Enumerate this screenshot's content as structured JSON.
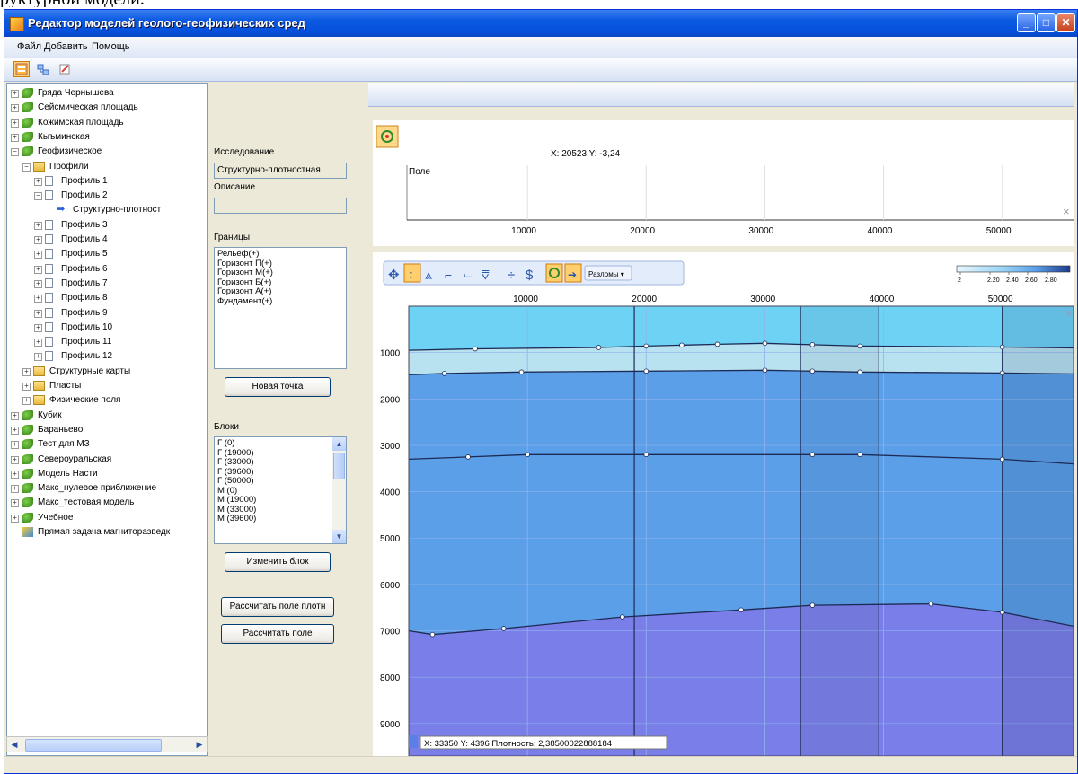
{
  "doc_text": "руктурной модели.",
  "window": {
    "title": "Редактор моделей геолого-геофизических сред",
    "minimize": "_",
    "maximize": "□",
    "close": "✕"
  },
  "menu": {
    "file": "Файл",
    "add": "Добавить",
    "help": "Помощь"
  },
  "tree": {
    "items": [
      {
        "label": "Гряда Чернышева",
        "icon": "leaf-icon",
        "level": 0,
        "exp": "+"
      },
      {
        "label": "Сейсмическая площадь",
        "icon": "leaf-icon",
        "level": 0,
        "exp": "+"
      },
      {
        "label": "Кожимская площадь",
        "icon": "leaf-icon",
        "level": 0,
        "exp": "+"
      },
      {
        "label": "Кыъминская",
        "icon": "leaf-icon",
        "level": 0,
        "exp": "+"
      },
      {
        "label": "Геофизическое",
        "icon": "leaf-icon",
        "level": 0,
        "exp": "−"
      },
      {
        "label": "Профили",
        "icon": "folder-icon",
        "level": 1,
        "exp": "−"
      },
      {
        "label": "Профиль 1",
        "icon": "doc-icon",
        "level": 2,
        "exp": "+"
      },
      {
        "label": "Профиль 2",
        "icon": "doc-icon",
        "level": 2,
        "exp": "−"
      },
      {
        "label": "Структурно-плотност",
        "icon": "arrow-icon",
        "level": 3,
        "exp": ""
      },
      {
        "label": "Профиль 3",
        "icon": "doc-icon",
        "level": 2,
        "exp": "+"
      },
      {
        "label": "Профиль 4",
        "icon": "doc-icon",
        "level": 2,
        "exp": "+"
      },
      {
        "label": "Профиль 5",
        "icon": "doc-icon",
        "level": 2,
        "exp": "+"
      },
      {
        "label": "Профиль 6",
        "icon": "doc-icon",
        "level": 2,
        "exp": "+"
      },
      {
        "label": "Профиль 7",
        "icon": "doc-icon",
        "level": 2,
        "exp": "+"
      },
      {
        "label": "Профиль 8",
        "icon": "doc-icon",
        "level": 2,
        "exp": "+"
      },
      {
        "label": "Профиль 9",
        "icon": "doc-icon",
        "level": 2,
        "exp": "+"
      },
      {
        "label": "Профиль 10",
        "icon": "doc-icon",
        "level": 2,
        "exp": "+"
      },
      {
        "label": "Профиль 11",
        "icon": "doc-icon",
        "level": 2,
        "exp": "+"
      },
      {
        "label": "Профиль 12",
        "icon": "doc-icon",
        "level": 2,
        "exp": "+"
      },
      {
        "label": "Структурные карты",
        "icon": "folder-icon",
        "level": 1,
        "exp": "+"
      },
      {
        "label": "Пласты",
        "icon": "folder-icon",
        "level": 1,
        "exp": "+"
      },
      {
        "label": "Физические поля",
        "icon": "folder-icon",
        "level": 1,
        "exp": "+"
      },
      {
        "label": "Кубик",
        "icon": "leaf-icon",
        "level": 0,
        "exp": "+"
      },
      {
        "label": "Бараньево",
        "icon": "leaf-icon",
        "level": 0,
        "exp": "+"
      },
      {
        "label": "Тест для МЗ",
        "icon": "leaf-icon",
        "level": 0,
        "exp": "+"
      },
      {
        "label": "Североуральская",
        "icon": "leaf-icon",
        "level": 0,
        "exp": "+"
      },
      {
        "label": "Модель Насти",
        "icon": "leaf-icon",
        "level": 0,
        "exp": "+"
      },
      {
        "label": "Макс_нулевое приближение",
        "icon": "leaf-icon",
        "level": 0,
        "exp": "+"
      },
      {
        "label": "Макс_тестовая модель",
        "icon": "leaf-icon",
        "level": 0,
        "exp": "+"
      },
      {
        "label": "Учебное",
        "icon": "leaf-icon",
        "level": 0,
        "exp": "+"
      },
      {
        "label": "Прямая задача магниторазведк",
        "icon": "cube-icon",
        "level": 0,
        "exp": ""
      }
    ]
  },
  "panel": {
    "research_label": "Исследование",
    "research_value": "Структурно-плотностная",
    "description_label": "Описание",
    "description_value": "",
    "boundaries_label": "Границы",
    "boundaries": [
      "Рельеф(+)",
      "Горизонт П(+)",
      "Горизонт М(+)",
      "Горизонт Б(+)",
      "Горизонт А(+)",
      "Фундамент(+)"
    ],
    "new_point_btn": "Новая точка",
    "blocks_label": "Блоки",
    "blocks": [
      "Г (0)",
      "Г (19000)",
      "Г (33000)",
      "Г (39600)",
      "Г (50000)",
      "М (0)",
      "М (19000)",
      "М (33000)",
      "М (39600)"
    ],
    "change_block_btn": "Изменить блок",
    "calc_density_btn": "Рассчитать поле плотн",
    "calc_field_btn": "Рассчитать поле"
  },
  "top_plot": {
    "coord_readout": "X: 20523 Y: -3,24",
    "field_label": "Поле",
    "x_ticks": [
      "10000",
      "20000",
      "30000",
      "40000",
      "50000"
    ],
    "close": "×"
  },
  "main_plot": {
    "palettes_btn": "Разломы ▾",
    "close": "×",
    "x_ticks": [
      "10000",
      "20000",
      "30000",
      "40000",
      "50000"
    ],
    "y_ticks": [
      "1000",
      "2000",
      "3000",
      "4000",
      "5000",
      "6000",
      "7000",
      "8000",
      "9000"
    ],
    "status": "X: 33350 Y: 4396 Плотность: 2,38500022888184",
    "legend_labels": [
      "2",
      "2.20",
      "2.40",
      "2.60",
      "2.80"
    ]
  },
  "chart_data": {
    "type": "area",
    "title": "",
    "xlabel": "",
    "ylabel": "",
    "xlim": [
      0,
      56000
    ],
    "ylim": [
      9700,
      0
    ],
    "x_ticks": [
      10000,
      20000,
      30000,
      40000,
      50000
    ],
    "y_ticks": [
      1000,
      2000,
      3000,
      4000,
      5000,
      6000,
      7000,
      8000,
      9000
    ],
    "boundaries": [
      {
        "name": "Горизонт П",
        "x": [
          0,
          5600,
          16000,
          20000,
          23000,
          26000,
          30000,
          34000,
          38000,
          50000,
          56000
        ],
        "y": [
          950,
          920,
          890,
          860,
          840,
          820,
          800,
          830,
          860,
          880,
          900
        ]
      },
      {
        "name": "Горизонт М",
        "x": [
          0,
          3000,
          9500,
          20000,
          30000,
          34000,
          38000,
          50000,
          56000
        ],
        "y": [
          1480,
          1450,
          1420,
          1400,
          1380,
          1400,
          1420,
          1440,
          1460
        ]
      },
      {
        "name": "Горизонт Б",
        "x": [
          0,
          5000,
          10000,
          20000,
          34000,
          38000,
          50000,
          56000
        ],
        "y": [
          3300,
          3250,
          3200,
          3200,
          3200,
          3200,
          3300,
          3400
        ]
      },
      {
        "name": "Фундамент",
        "x": [
          0,
          2000,
          8000,
          18000,
          28000,
          34000,
          44000,
          50000,
          56000
        ],
        "y": [
          7000,
          7080,
          6950,
          6700,
          6550,
          6450,
          6420,
          6600,
          6900
        ]
      }
    ],
    "vertical_lines_x": [
      19000,
      33000,
      39600,
      50000
    ],
    "layer_colors": [
      "#6ed2f5",
      "#b8e2ef",
      "#5b9fe8",
      "#5b9fe8",
      "#7a7ee8"
    ]
  }
}
